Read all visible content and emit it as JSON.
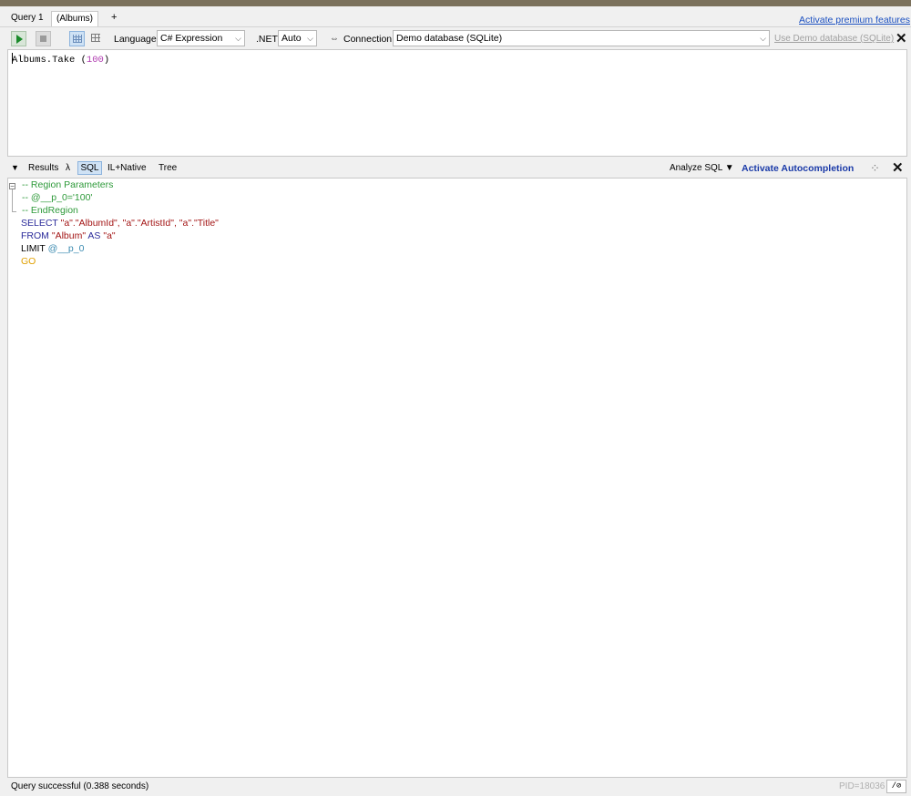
{
  "tabs": [
    {
      "label": "Query 1"
    },
    {
      "label": "(Albums)"
    },
    {
      "label": "+"
    }
  ],
  "premium_link": "Activate premium features",
  "toolbar": {
    "run_icon": "play-icon",
    "stop_icon": "stop-icon",
    "language_label": "Language",
    "language_value": "C# Expression",
    "dotnet_label": ".NET",
    "dotnet_value": "Auto",
    "connection_label": "Connection",
    "connection_value": "Demo database (SQLite)",
    "use_demo_link": "Use Demo database (SQLite)",
    "close": "✕"
  },
  "editor": {
    "code_prefix": "Albums.Take (",
    "code_number": "100",
    "code_suffix": ")"
  },
  "results_toolbar": {
    "collapse": "▼",
    "results": "Results",
    "lambda": "λ",
    "sql": "SQL",
    "il": "IL+Native",
    "tree": "Tree",
    "analyze": "Analyze SQL ▼",
    "autocompletion": "Activate Autocompletion",
    "close": "✕"
  },
  "sql": {
    "region_start": "-- Region Parameters",
    "param_prefix": "-- ",
    "param_line": "@__p_0='100'",
    "region_end": "-- EndRegion",
    "select_kw": "SELECT",
    "select_cols": "\"a\".\"AlbumId\", \"a\".\"ArtistId\", \"a\".\"Title\"",
    "from_kw": "FROM",
    "from_table": "\"Album\"",
    "as_kw": "AS",
    "alias": "\"a\"",
    "limit_kw": "LIMIT",
    "limit_param": "@__p_0",
    "go": "GO"
  },
  "status": {
    "message": "Query successful  (0.388 seconds)",
    "pid": "PID=18036",
    "icon_text": "/⊘"
  }
}
